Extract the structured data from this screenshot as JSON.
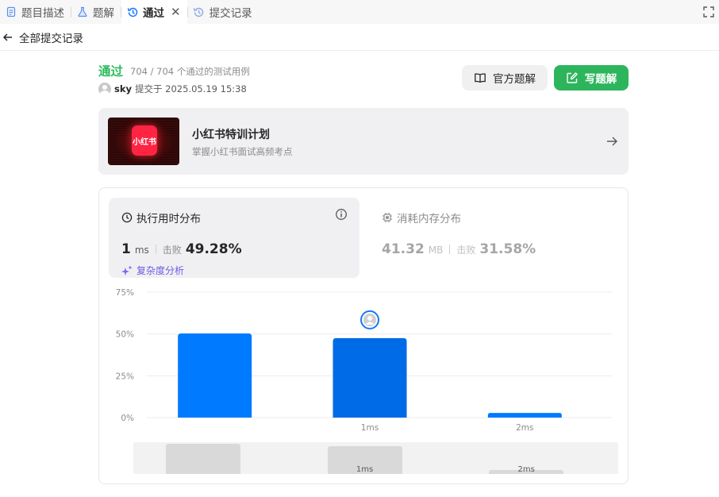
{
  "tabs": [
    {
      "label": "题目描述",
      "icon": "document-icon"
    },
    {
      "label": "题解",
      "icon": "flask-icon"
    },
    {
      "label": "通过",
      "icon": "history-icon",
      "active": true
    },
    {
      "label": "提交记录",
      "icon": "history-icon"
    }
  ],
  "back": {
    "label": "全部提交记录"
  },
  "submission": {
    "status": "通过",
    "testcases": "704 / 704 个通过的测试用例",
    "username": "sky",
    "submitted_at": "提交于 2025.05.19 15:38"
  },
  "buttons": {
    "official": "官方题解",
    "write": "写题解"
  },
  "promo": {
    "logo_text": "小红书",
    "title": "小红书特训计划",
    "subtitle": "掌握小红书面试高频考点"
  },
  "runtime": {
    "title": "执行用时分布",
    "value": "1",
    "unit": "ms",
    "beat_label": "击败",
    "beat_pct": "49.28%",
    "complexity_link": "复杂度分析"
  },
  "memory": {
    "title": "消耗内存分布",
    "value": "41.32",
    "unit": "MB",
    "beat_label": "击败",
    "beat_pct": "31.58%"
  },
  "colors": {
    "accepted": "#2cbb5d",
    "bar": "#007aff",
    "bar_selected": "#006be6",
    "write_button": "#2db55d"
  },
  "chart_data": {
    "type": "bar",
    "categories": [
      "",
      "1ms",
      "2ms"
    ],
    "values": [
      50.3,
      47.5,
      2.8
    ],
    "selected_index": 1,
    "ylim": [
      0,
      75
    ],
    "yticks": [
      "0%",
      "25%",
      "50%",
      "75%"
    ],
    "grid": true
  },
  "minimap": {
    "labels": [
      "",
      "1ms",
      "2ms"
    ],
    "values": [
      50.3,
      47.5,
      2.8
    ]
  }
}
